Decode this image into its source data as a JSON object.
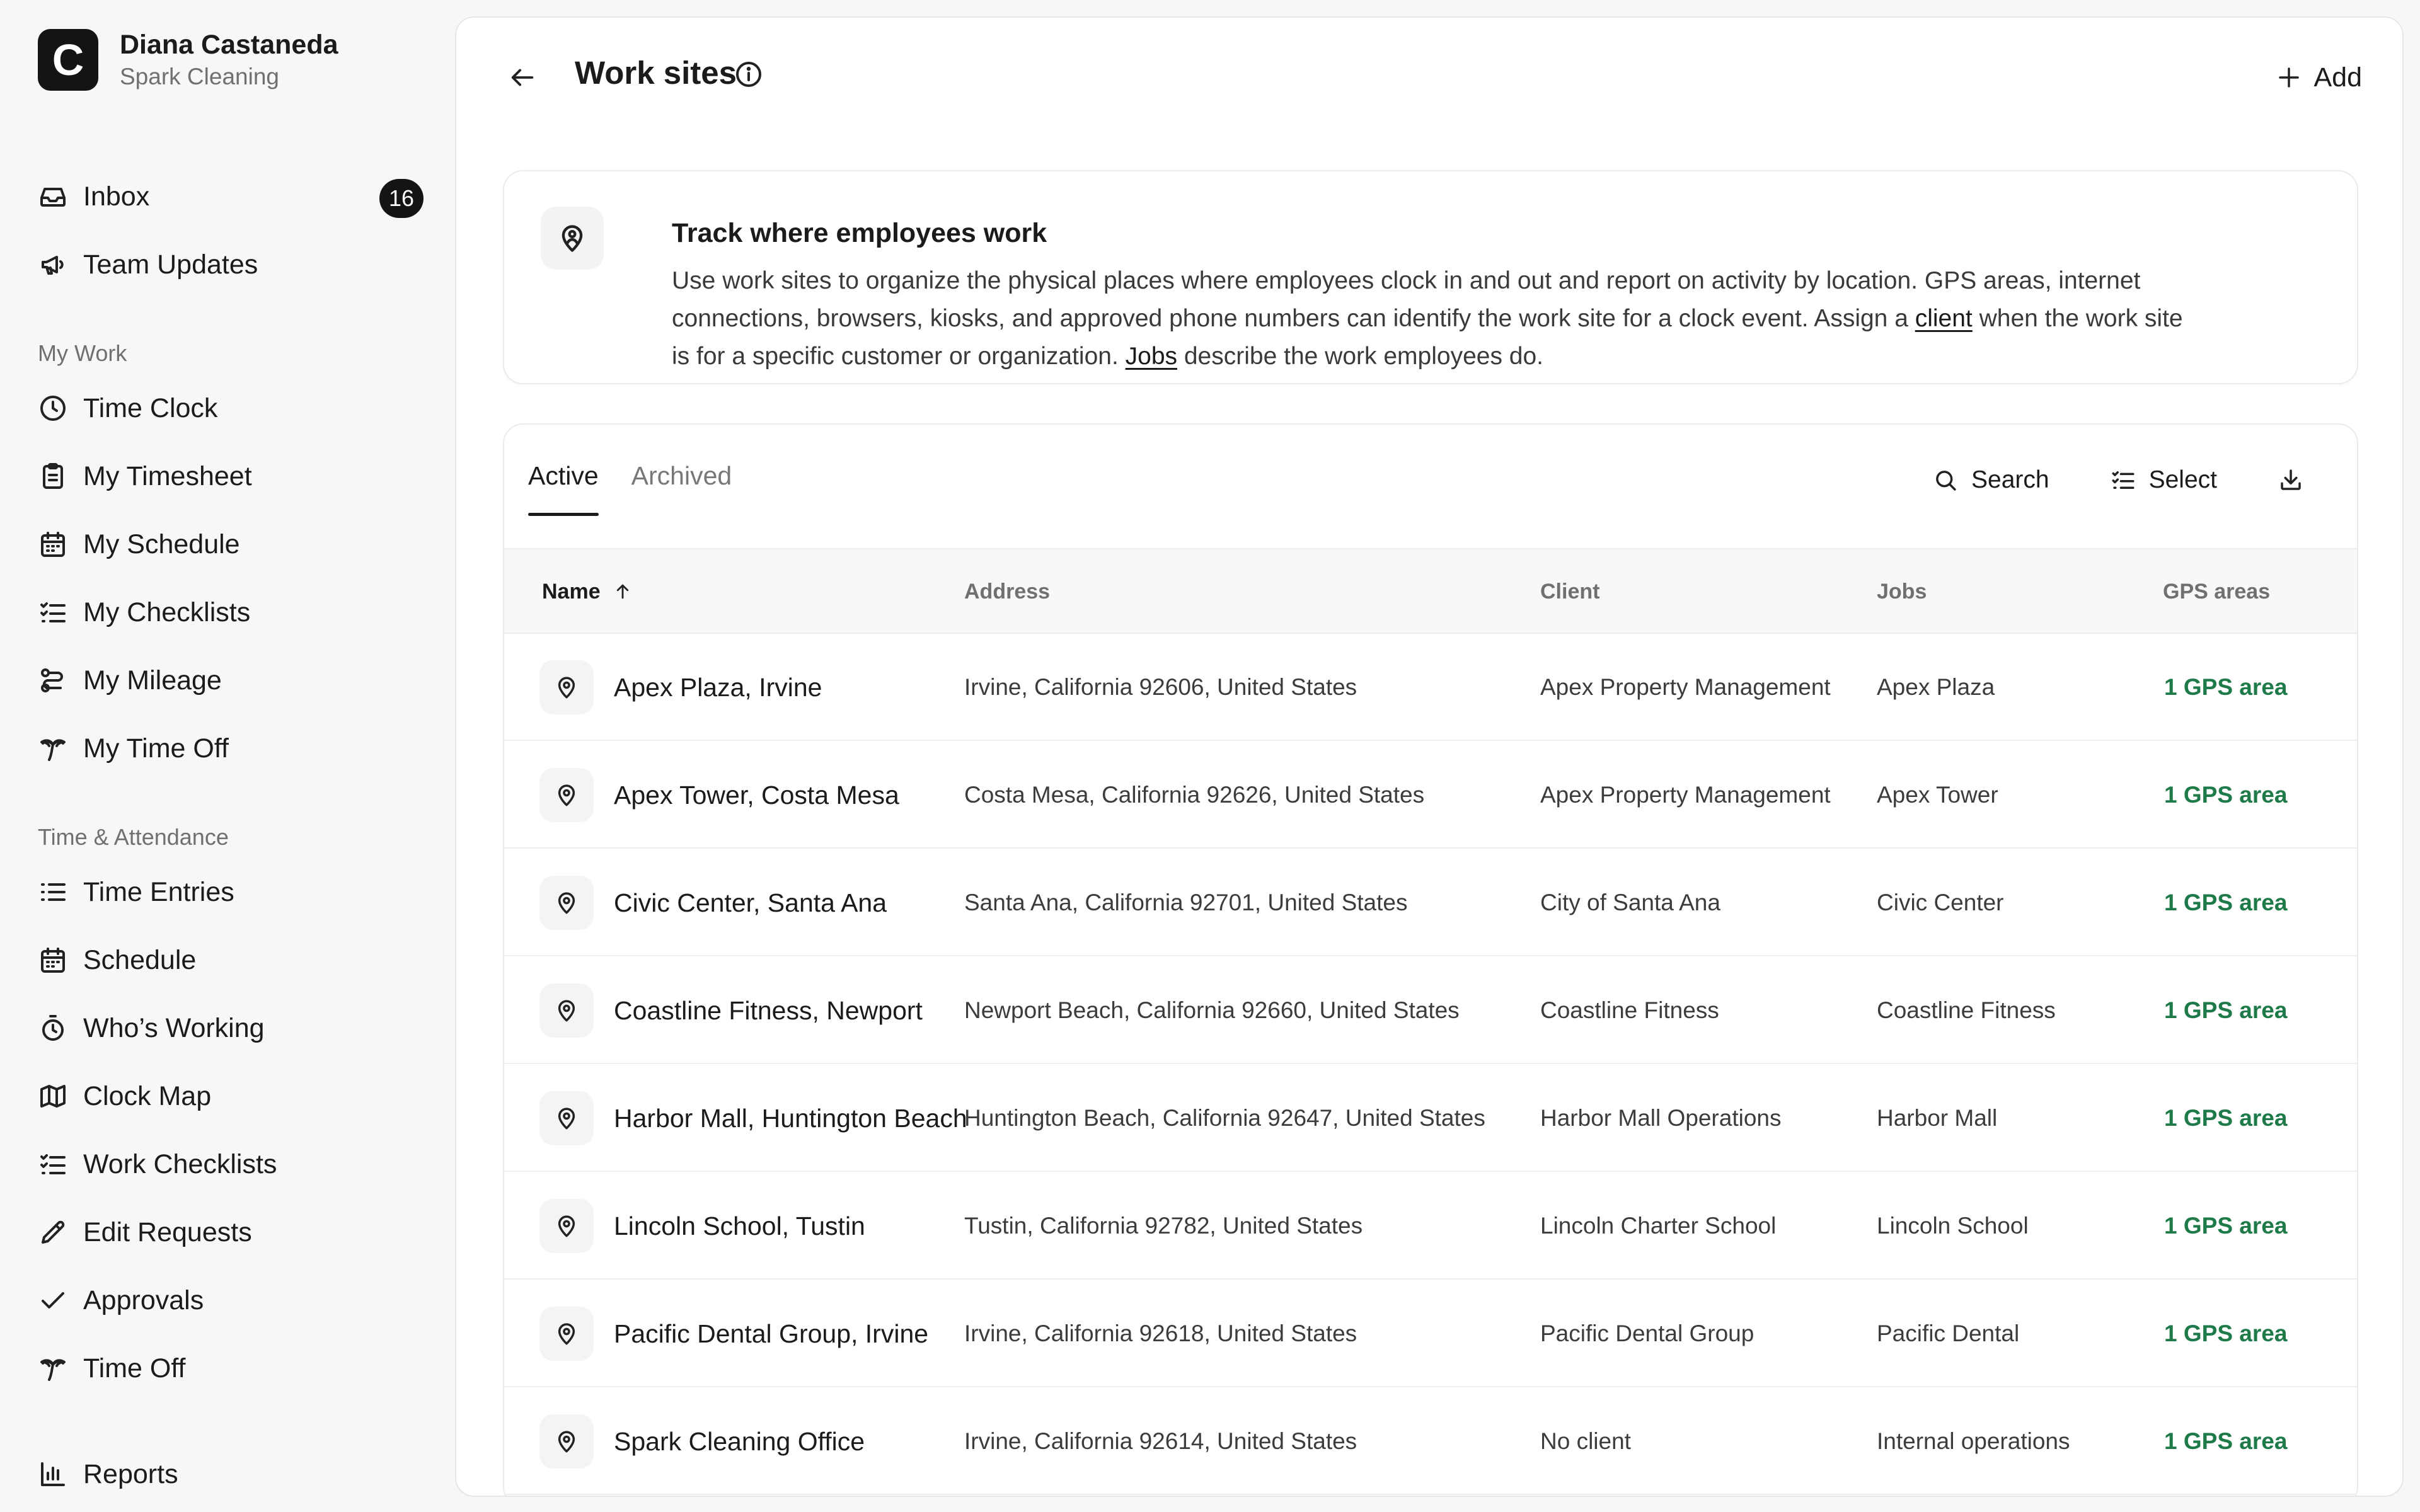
{
  "user": {
    "name": "Diana Castaneda",
    "company": "Spark Cleaning",
    "logo_letter": "C"
  },
  "sidebar": {
    "top_items": [
      {
        "label": "Inbox",
        "icon": "inbox-icon",
        "badge": "16"
      },
      {
        "label": "Team Updates",
        "icon": "megaphone-icon"
      }
    ],
    "my_work": {
      "heading": "My Work",
      "items": [
        {
          "label": "Time Clock",
          "icon": "clock-icon"
        },
        {
          "label": "My Timesheet",
          "icon": "clipboard-icon"
        },
        {
          "label": "My Schedule",
          "icon": "calendar-icon"
        },
        {
          "label": "My Checklists",
          "icon": "checklist-icon"
        },
        {
          "label": "My Mileage",
          "icon": "route-icon"
        },
        {
          "label": "My Time Off",
          "icon": "palm-tree-icon"
        }
      ]
    },
    "time_attendance": {
      "heading": "Time & Attendance",
      "items": [
        {
          "label": "Time Entries",
          "icon": "list-icon"
        },
        {
          "label": "Schedule",
          "icon": "calendar-icon"
        },
        {
          "label": "Who’s Working",
          "icon": "stopwatch-icon"
        },
        {
          "label": "Clock Map",
          "icon": "map-icon"
        },
        {
          "label": "Work Checklists",
          "icon": "checklist-icon"
        },
        {
          "label": "Edit Requests",
          "icon": "pencil-icon"
        },
        {
          "label": "Approvals",
          "icon": "check-icon"
        },
        {
          "label": "Time Off",
          "icon": "palm-tree-icon"
        }
      ]
    },
    "reports": {
      "label": "Reports",
      "icon": "bar-chart-icon"
    }
  },
  "header": {
    "title": "Work sites",
    "add_label": "Add"
  },
  "info_card": {
    "title": "Track where employees work",
    "body_1": "Use work sites to organize the physical places where employees clock in and out and report on activity by location. GPS areas, internet connections, browsers, kiosks, and approved phone numbers can identify the work site for a clock event. Assign a ",
    "link_client": "client",
    "body_2": " when the work site is for a specific customer or organization. ",
    "link_jobs": "Jobs",
    "body_3": " describe the work employees do."
  },
  "tabs": {
    "active": "Active",
    "archived": "Archived"
  },
  "toolbar": {
    "search": "Search",
    "select": "Select"
  },
  "table": {
    "columns": {
      "name": "Name",
      "address": "Address",
      "client": "Client",
      "jobs": "Jobs",
      "gps": "GPS areas"
    },
    "rows": [
      {
        "name": "Apex Plaza, Irvine",
        "address": "Irvine, California 92606, United States",
        "client": "Apex Property Management",
        "jobs": "Apex Plaza",
        "gps": "1 GPS area"
      },
      {
        "name": "Apex Tower, Costa Mesa",
        "address": "Costa Mesa, California 92626, United States",
        "client": "Apex Property Management",
        "jobs": "Apex Tower",
        "gps": "1 GPS area"
      },
      {
        "name": "Civic Center, Santa Ana",
        "address": "Santa Ana, California 92701, United States",
        "client": "City of Santa Ana",
        "jobs": "Civic Center",
        "gps": "1 GPS area"
      },
      {
        "name": "Coastline Fitness, Newport",
        "address": "Newport Beach, California 92660, United States",
        "client": "Coastline Fitness",
        "jobs": "Coastline Fitness",
        "gps": "1 GPS area"
      },
      {
        "name": "Harbor Mall, Huntington Beach",
        "address": "Huntington Beach, California 92647, United States",
        "client": "Harbor Mall Operations",
        "jobs": "Harbor Mall",
        "gps": "1 GPS area"
      },
      {
        "name": "Lincoln School, Tustin",
        "address": "Tustin, California 92782, United States",
        "client": "Lincoln Charter School",
        "jobs": "Lincoln School",
        "gps": "1 GPS area"
      },
      {
        "name": "Pacific Dental Group, Irvine",
        "address": "Irvine, California 92618, United States",
        "client": "Pacific Dental Group",
        "jobs": "Pacific Dental",
        "gps": "1 GPS area"
      },
      {
        "name": "Spark Cleaning Office",
        "address": "Irvine, California 92614, United States",
        "client": "No client",
        "jobs": "Internal operations",
        "gps": "1 GPS area"
      }
    ]
  },
  "colors": {
    "accent_green": "#1e7a48",
    "text": "#1b1b1b",
    "muted": "#707070",
    "badge_bg": "#141414"
  }
}
